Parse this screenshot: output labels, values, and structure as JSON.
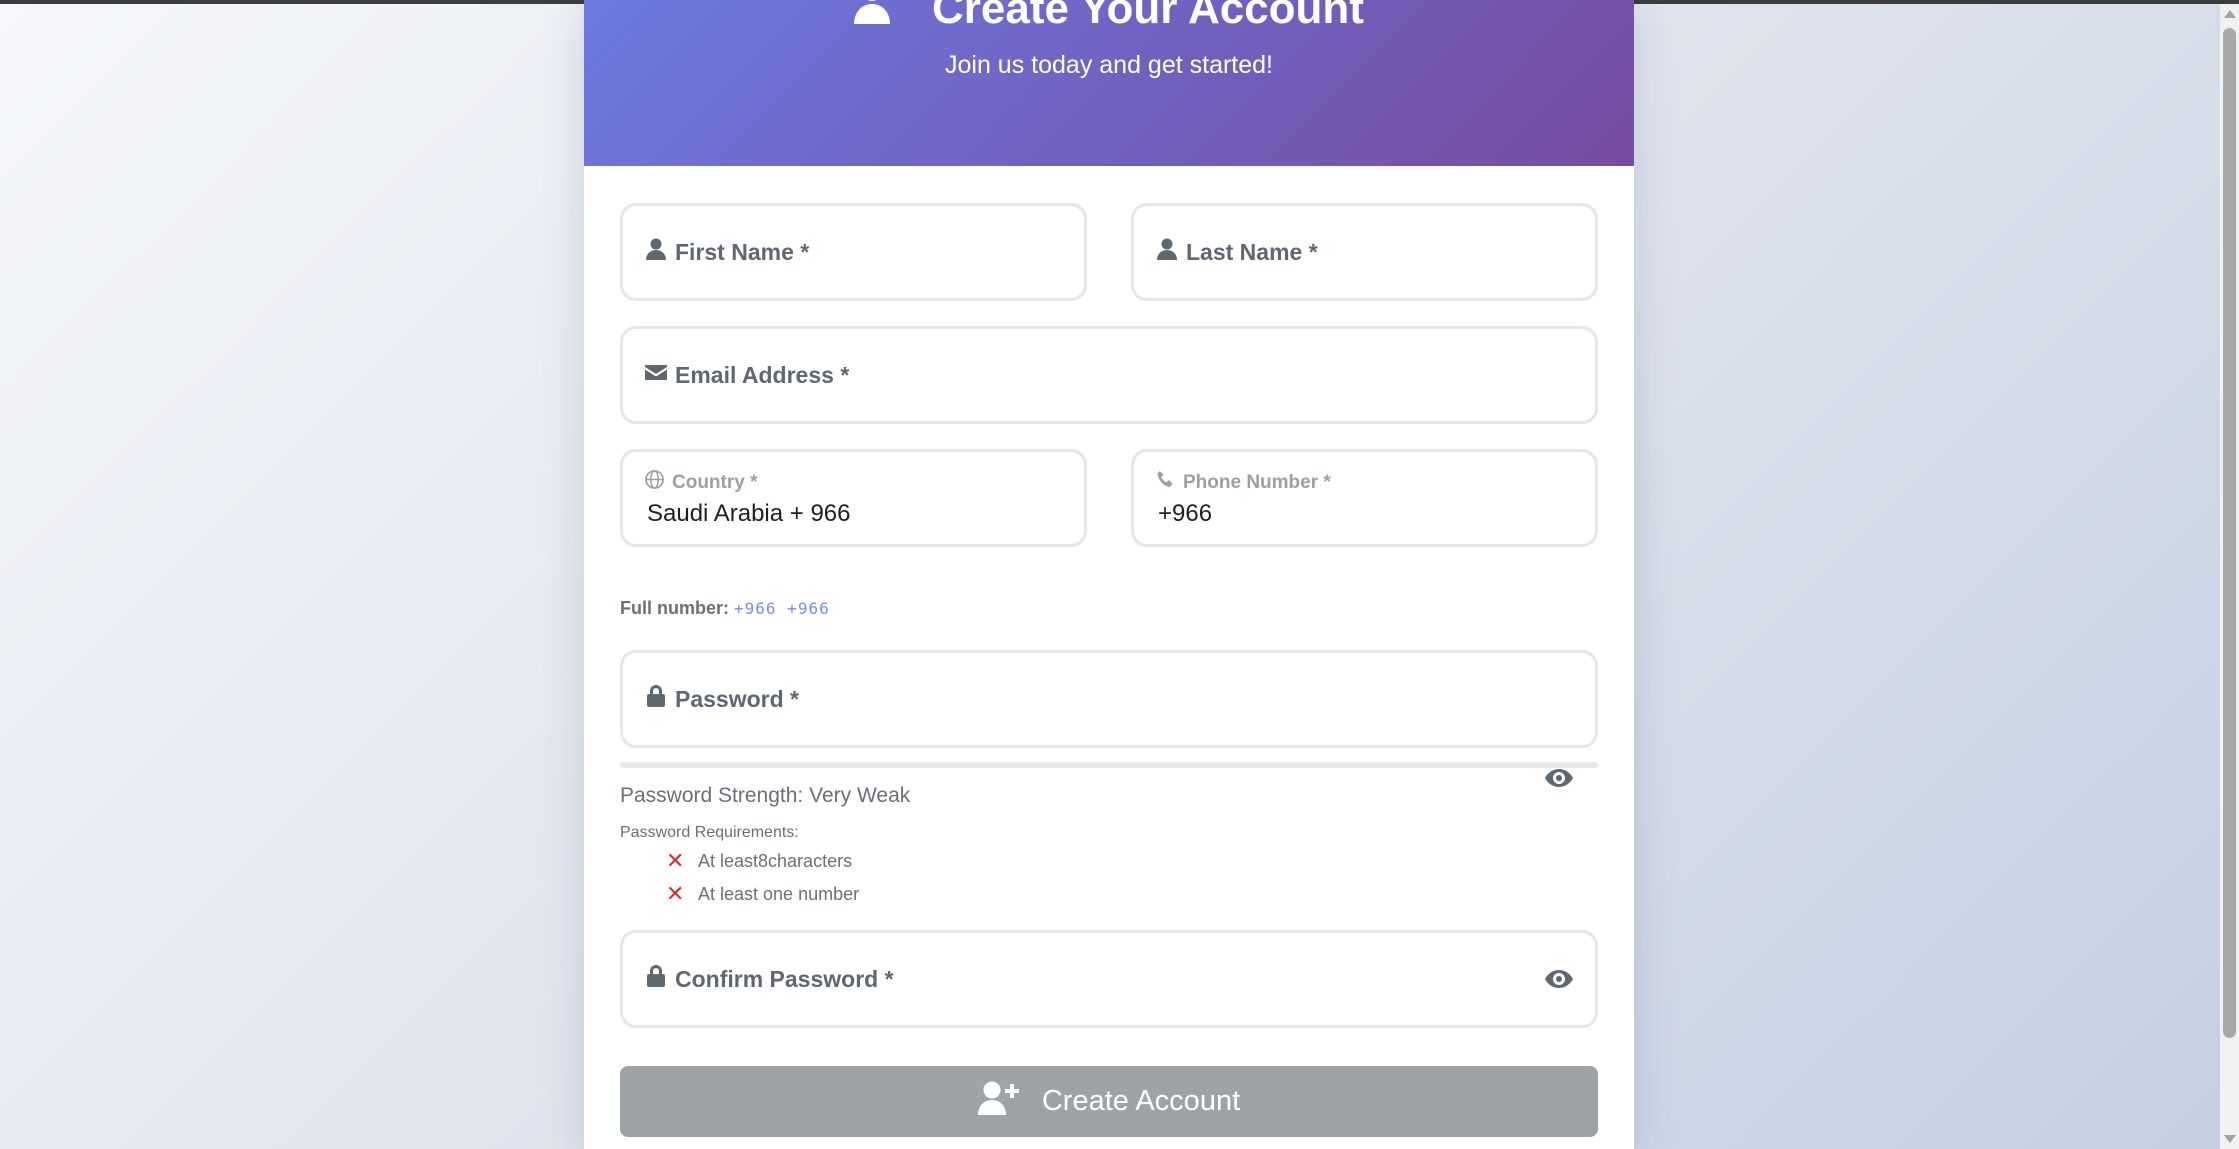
{
  "header": {
    "title": "Create Your Account",
    "subtitle": "Join us today and get started!"
  },
  "form": {
    "first_name": {
      "label": "First Name *",
      "icon": "user-icon"
    },
    "last_name": {
      "label": "Last Name *",
      "icon": "user-icon"
    },
    "email": {
      "label": "Email Address *",
      "icon": "envelope-icon"
    },
    "country": {
      "label": "Country *",
      "value": "Saudi Arabia + 966",
      "icon": "globe-icon"
    },
    "phone": {
      "label": "Phone Number *",
      "value": "+966",
      "icon": "phone-icon"
    },
    "full_number": {
      "label": "Full number:",
      "value": "+966 +966"
    },
    "password": {
      "label": "Password *",
      "icon": "lock-icon"
    },
    "strength": {
      "text": "Password Strength: Very Weak",
      "level": 0
    },
    "requirements": {
      "title": "Password Requirements:",
      "items": [
        {
          "text": "At least8characters",
          "met": false
        },
        {
          "text": "At least one number",
          "met": false
        }
      ]
    },
    "confirm_password": {
      "label": "Confirm Password *",
      "icon": "lock-icon"
    },
    "submit_label": "Create Account"
  },
  "colors": {
    "header_gradient_start": "#6c7ae0",
    "header_gradient_end": "#764ba2",
    "button_disabled": "#9ea3a8",
    "requirement_fail": "#d92c2c"
  }
}
